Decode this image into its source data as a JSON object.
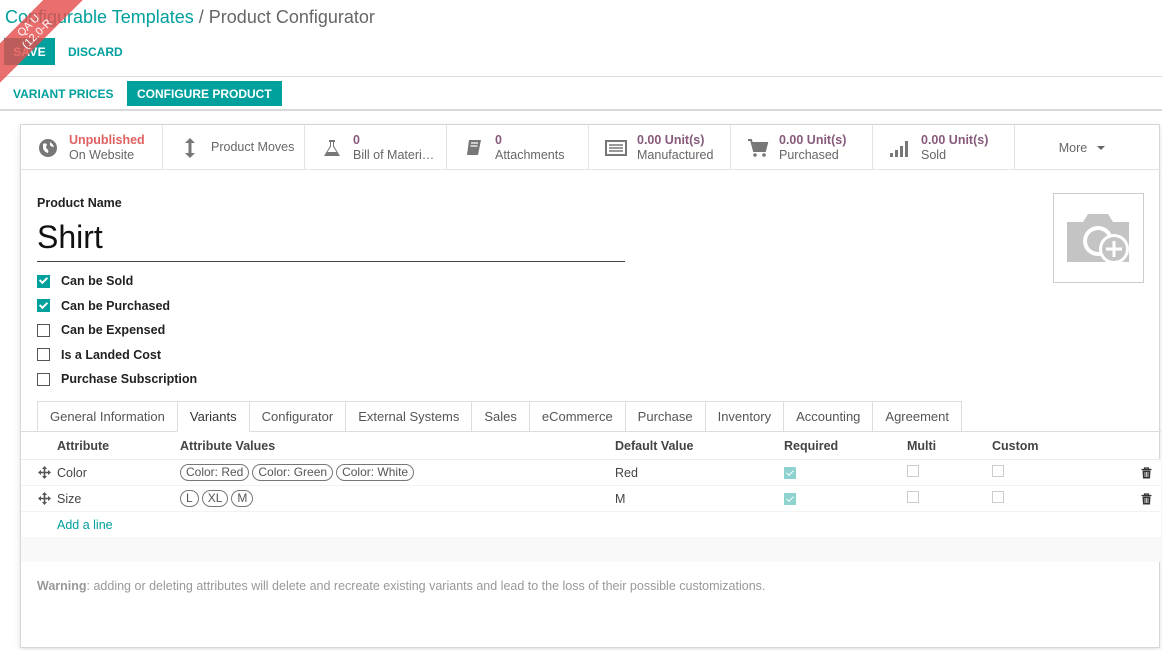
{
  "ribbon": {
    "line1": "QA U",
    "line2": "(12.0-R"
  },
  "breadcrumb": {
    "parent": "Configurable Templates",
    "separator": "/",
    "current": "Product Configurator"
  },
  "actions": {
    "save": "SAVE",
    "discard": "DISCARD"
  },
  "statusbar": {
    "variant_prices": "VARIANT PRICES",
    "configure_product": "CONFIGURE PRODUCT"
  },
  "stats": {
    "website": {
      "value": "Unpublished",
      "label": "On Website",
      "icon": "globe-icon"
    },
    "moves": {
      "label": "Product Moves",
      "icon": "updown-arrows-icon"
    },
    "bom": {
      "value": "0",
      "label": "Bill of Materi…",
      "icon": "flask-icon"
    },
    "attachments": {
      "value": "0",
      "label": "Attachments",
      "icon": "book-icon"
    },
    "manufactured": {
      "value": "0.00 Unit(s)",
      "label": "Manufactured",
      "icon": "list-icon"
    },
    "purchased": {
      "value": "0.00 Unit(s)",
      "label": "Purchased",
      "icon": "cart-icon"
    },
    "sold": {
      "value": "0.00 Unit(s)",
      "label": "Sold",
      "icon": "signal-icon"
    },
    "more": "More"
  },
  "product": {
    "name_label": "Product Name",
    "name": "Shirt",
    "image_icon": "camera-plus-icon"
  },
  "options": [
    {
      "label": "Can be Sold",
      "checked": true
    },
    {
      "label": "Can be Purchased",
      "checked": true
    },
    {
      "label": "Can be Expensed",
      "checked": false
    },
    {
      "label": "Is a Landed Cost",
      "checked": false
    },
    {
      "label": "Purchase Subscription",
      "checked": false
    }
  ],
  "tabs": [
    "General Information",
    "Variants",
    "Configurator",
    "External Systems",
    "Sales",
    "eCommerce",
    "Purchase",
    "Inventory",
    "Accounting",
    "Agreement"
  ],
  "active_tab": "Variants",
  "table": {
    "headers": {
      "attribute": "Attribute",
      "values": "Attribute Values",
      "default": "Default Value",
      "required": "Required",
      "multi": "Multi",
      "custom": "Custom"
    },
    "rows": [
      {
        "attribute": "Color",
        "values": [
          "Color: Red",
          "Color: Green",
          "Color: White"
        ],
        "default": "Red",
        "required": true,
        "multi": false,
        "custom": false
      },
      {
        "attribute": "Size",
        "values": [
          "L",
          "XL",
          "M"
        ],
        "default": "M",
        "required": true,
        "multi": false,
        "custom": false
      }
    ],
    "add_line": "Add a line"
  },
  "warning": {
    "title": "Warning",
    "text": ": adding or deleting attributes will delete and recreate existing variants and lead to the loss of their possible customizations."
  },
  "colors": {
    "accent": "#00a09d",
    "stat_value": "#875a7b",
    "unpublished": "#e06060"
  }
}
